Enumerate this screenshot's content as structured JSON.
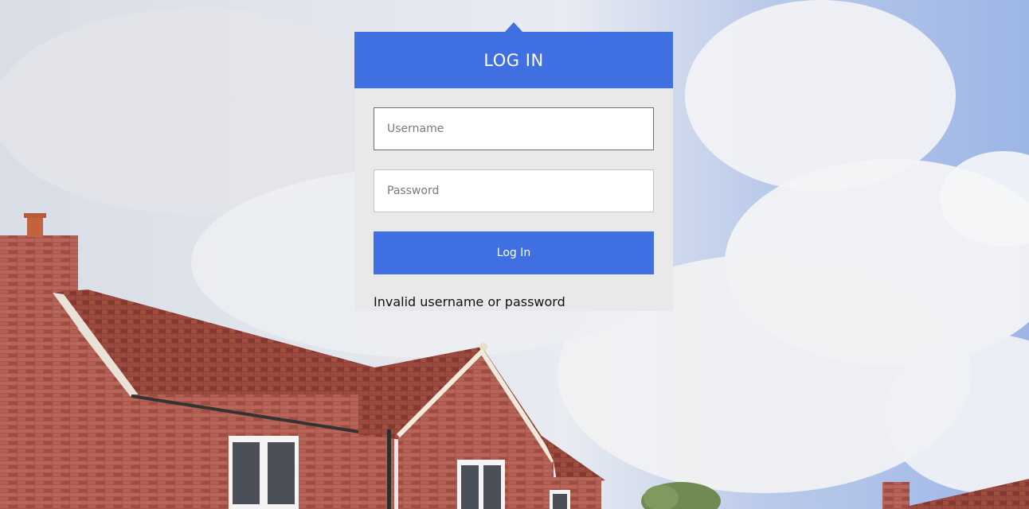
{
  "login": {
    "title": "LOG IN",
    "username_placeholder": "Username",
    "password_placeholder": "Password",
    "submit_label": "Log In",
    "error_message": "Invalid username or password"
  },
  "colors": {
    "accent": "#3f6fe0",
    "panel": "#e9e9e9"
  }
}
